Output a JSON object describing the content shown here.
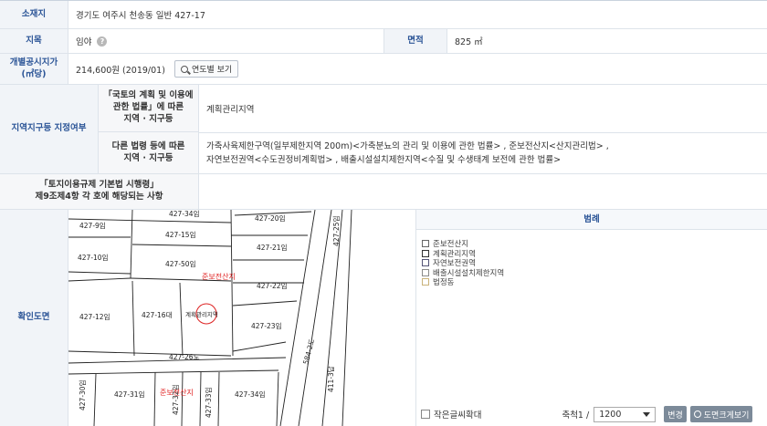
{
  "rows": {
    "location": {
      "label": "소재지",
      "value": "경기도 여주시 천송동 일반 427-17"
    },
    "land_category": {
      "label": "지목",
      "value": "임야",
      "area_label": "면적",
      "area_value": "825 ㎡"
    },
    "price": {
      "label_line1": "개별공시지가",
      "label_line2": "(㎡당)",
      "value": "214,600원 (2019/01)",
      "button": "연도별 보기"
    },
    "zoning": {
      "label": "지역지구등 지정여부",
      "sub1_line1": "「국토의 계획 및 이용에",
      "sub1_line2": "관한 법률」에 따른",
      "sub1_line3": "지역 · 지구등",
      "value1": "계획관리지역",
      "sub2_line1": "다른 법령 등에 따른",
      "sub2_line2": "지역 · 지구등",
      "value2_line1": "가축사육제한구역(일부제한지역 200m)<가축분뇨의 관리 및 이용에 관한 법률> , 준보전산지<산지관리법> ,",
      "value2_line2": "자연보전권역<수도권정비계획법> , 배출시설설치제한지역<수질 및 수생태계 보전에 관한 법률>"
    },
    "enforcement": {
      "label_line1": "「토지이용규제 기본법 시행령」",
      "label_line2": "제9조제4항 각 호에 해당되는 사항",
      "value": ""
    },
    "map_row": {
      "label": "확인도면"
    }
  },
  "map": {
    "parcels": [
      "427-34임",
      "427-9임",
      "427-15임",
      "427-20임",
      "427-10임",
      "427-21임",
      "427-50임",
      "427-22임",
      "427-12임",
      "427-16대",
      "427-23임",
      "427-26도",
      "427-31임",
      "427-32임",
      "427-33임",
      "427-34임",
      "427-30임",
      "427-25임",
      "411-3답",
      "584-2도"
    ],
    "subject_label": "계획관리지역",
    "zone_labels": [
      "준보전산지",
      "준보전산지"
    ]
  },
  "legend": {
    "title": "범례",
    "items": [
      {
        "label": "준보전산지",
        "color": "#ffffff"
      },
      {
        "label": "계획관리지역",
        "color": "#ffffff"
      },
      {
        "label": "자연보전권역",
        "color": "#ffffff"
      },
      {
        "label": "배출시설설치제한지역",
        "color": "#ffffff"
      },
      {
        "label": "법정동",
        "color": "#ffffff"
      }
    ],
    "enlarge_text": "작은글씨확대",
    "scale_label": "축척1 /",
    "scale_value": "1200",
    "change_button": "변경",
    "enlarge_map_button": "도면크게보기"
  }
}
